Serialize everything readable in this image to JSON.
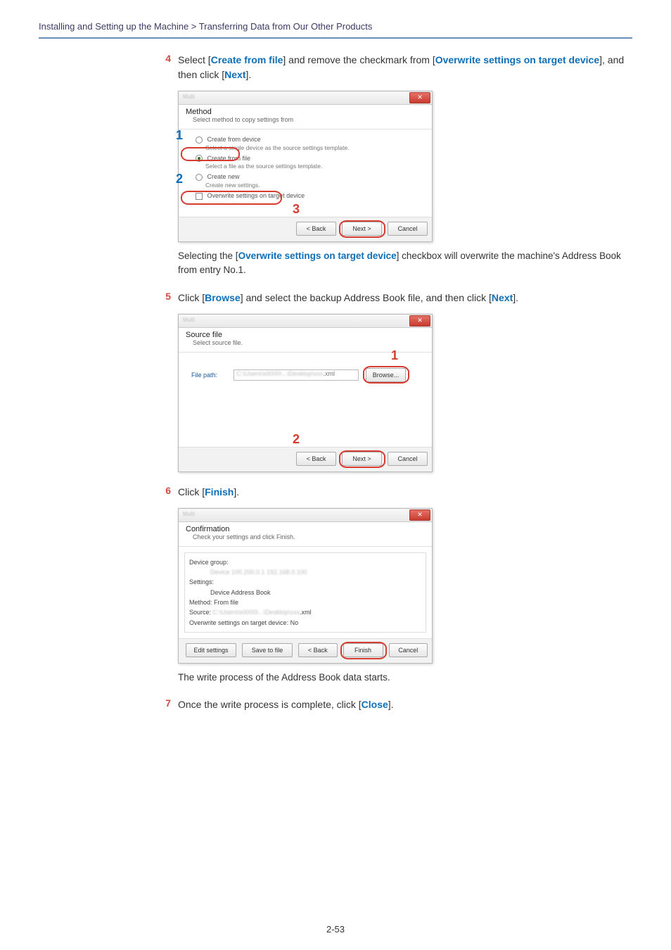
{
  "breadcrumb": "Installing and Setting up the Machine > Transferring Data from Our Other Products",
  "steps": {
    "s4": {
      "num": "4",
      "text_pre": "Select [",
      "link1": "Create from file",
      "text_mid": "] and remove the checkmark from [",
      "link2": "Overwrite settings on target device",
      "text_post": "], and then click [",
      "link3": "Next",
      "text_end": "]."
    },
    "note4_pre": "Selecting the [",
    "note4_link": "Overwrite settings on target device",
    "note4_post": "] checkbox will overwrite the machine's Address Book from entry No.1.",
    "s5": {
      "num": "5",
      "pre": "Click [",
      "l1": "Browse",
      "mid": "] and select the backup Address Book file, and then click [",
      "l2": "Next",
      "post": "]."
    },
    "s6": {
      "num": "6",
      "pre": "Click [",
      "l1": "Finish",
      "post": "]."
    },
    "note6": "The write process of the Address Book data starts.",
    "s7": {
      "num": "7",
      "pre": "Once the write process is complete, click [",
      "l1": "Close",
      "post": "]."
    }
  },
  "dlg1": {
    "title": "Method",
    "subtitle": "Select method to copy settings from",
    "opt1": "Create from device",
    "opt1_sub": "Select a single device as the source settings template.",
    "opt2": "Create from file",
    "opt2_sub": "Select a file as the source settings template.",
    "opt3": "Create new",
    "opt3_sub": "Create new settings.",
    "chk": "Overwrite settings on target device",
    "back": "< Back",
    "next": "Next >",
    "cancel": "Cancel"
  },
  "dlg2": {
    "title": "Source file",
    "subtitle": "Select source file.",
    "filepath_lbl": "File path:",
    "filepath_val": ".xml",
    "browse": "Browse...",
    "back": "< Back",
    "next": "Next >",
    "cancel": "Cancel"
  },
  "dlg3": {
    "title": "Confirmation",
    "subtitle": "Check your settings and click Finish.",
    "devgroup_lbl": "Device group:",
    "settings_lbl": "Settings:",
    "settings_val": "Device Address Book",
    "method_lbl": "Method:",
    "method_val": "From file",
    "source_lbl": "Source:",
    "source_val": ".xml",
    "overwrite_lbl": "Overwrite settings on target device:",
    "overwrite_val": "No",
    "edit": "Edit settings",
    "save": "Save to file",
    "back": "< Back",
    "finish": "Finish",
    "cancel": "Cancel"
  },
  "ann": {
    "one": "1",
    "two": "2",
    "three": "3"
  },
  "pagenum": "2-53"
}
